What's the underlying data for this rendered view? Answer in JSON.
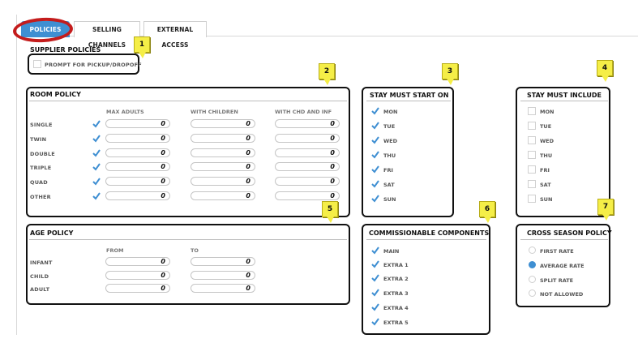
{
  "tabs": [
    {
      "label": "POLICIES",
      "active": true
    },
    {
      "label": "SELLING CHANNELS",
      "active": false
    },
    {
      "label": "EXTERNAL ACCESS",
      "active": false
    }
  ],
  "colors": {
    "accent": "#3f8fd2",
    "callout": "#f5ee47",
    "highlight_ring": "#c41c1c"
  },
  "supplier": {
    "title": "SUPPLIER POLICIES",
    "prompt_label": "PROMPT FOR PICKUP/DROPOFF",
    "prompt_checked": false,
    "callout": "1"
  },
  "room": {
    "title": "ROOM POLICY",
    "callout": "2",
    "columns": [
      "MAX ADULTS",
      "WITH CHILDREN",
      "WITH CHD AND INF"
    ],
    "rows": [
      {
        "label": "SINGLE",
        "checked": true,
        "values": [
          "0",
          "0",
          "0"
        ]
      },
      {
        "label": "TWIN",
        "checked": true,
        "values": [
          "0",
          "0",
          "0"
        ]
      },
      {
        "label": "DOUBLE",
        "checked": true,
        "values": [
          "0",
          "0",
          "0"
        ]
      },
      {
        "label": "TRIPLE",
        "checked": true,
        "values": [
          "0",
          "0",
          "0"
        ]
      },
      {
        "label": "QUAD",
        "checked": true,
        "values": [
          "0",
          "0",
          "0"
        ]
      },
      {
        "label": "OTHER",
        "checked": true,
        "values": [
          "0",
          "0",
          "0"
        ]
      }
    ]
  },
  "stay_start": {
    "title": "STAY MUST START ON",
    "callout": "3",
    "days": [
      {
        "label": "MON",
        "checked": true
      },
      {
        "label": "TUE",
        "checked": true
      },
      {
        "label": "WED",
        "checked": true
      },
      {
        "label": "THU",
        "checked": true
      },
      {
        "label": "FRI",
        "checked": true
      },
      {
        "label": "SAT",
        "checked": true
      },
      {
        "label": "SUN",
        "checked": true
      }
    ]
  },
  "stay_include": {
    "title": "STAY MUST INCLUDE",
    "callout": "4",
    "days": [
      {
        "label": "MON",
        "checked": false
      },
      {
        "label": "TUE",
        "checked": false
      },
      {
        "label": "WED",
        "checked": false
      },
      {
        "label": "THU",
        "checked": false
      },
      {
        "label": "FRI",
        "checked": false
      },
      {
        "label": "SAT",
        "checked": false
      },
      {
        "label": "SUN",
        "checked": false
      }
    ]
  },
  "age": {
    "title": "AGE POLICY",
    "callout": "5",
    "columns": [
      "FROM",
      "TO"
    ],
    "rows": [
      {
        "label": "INFANT",
        "values": [
          "0",
          "0"
        ]
      },
      {
        "label": "CHILD",
        "values": [
          "0",
          "0"
        ]
      },
      {
        "label": "ADULT",
        "values": [
          "0",
          "0"
        ]
      }
    ]
  },
  "components": {
    "title": "COMMISSIONABLE COMPONENTS",
    "callout": "6",
    "items": [
      {
        "label": "MAIN",
        "checked": true
      },
      {
        "label": "EXTRA 1",
        "checked": true
      },
      {
        "label": "EXTRA 2",
        "checked": true
      },
      {
        "label": "EXTRA 3",
        "checked": true
      },
      {
        "label": "EXTRA 4",
        "checked": true
      },
      {
        "label": "EXTRA 5",
        "checked": true
      }
    ]
  },
  "cross_season": {
    "title": "CROSS SEASON POLICY",
    "callout": "7",
    "options": [
      {
        "label": "FIRST RATE",
        "selected": false
      },
      {
        "label": "AVERAGE RATE",
        "selected": true
      },
      {
        "label": "SPLIT RATE",
        "selected": false
      },
      {
        "label": "NOT ALLOWED",
        "selected": false
      }
    ]
  }
}
